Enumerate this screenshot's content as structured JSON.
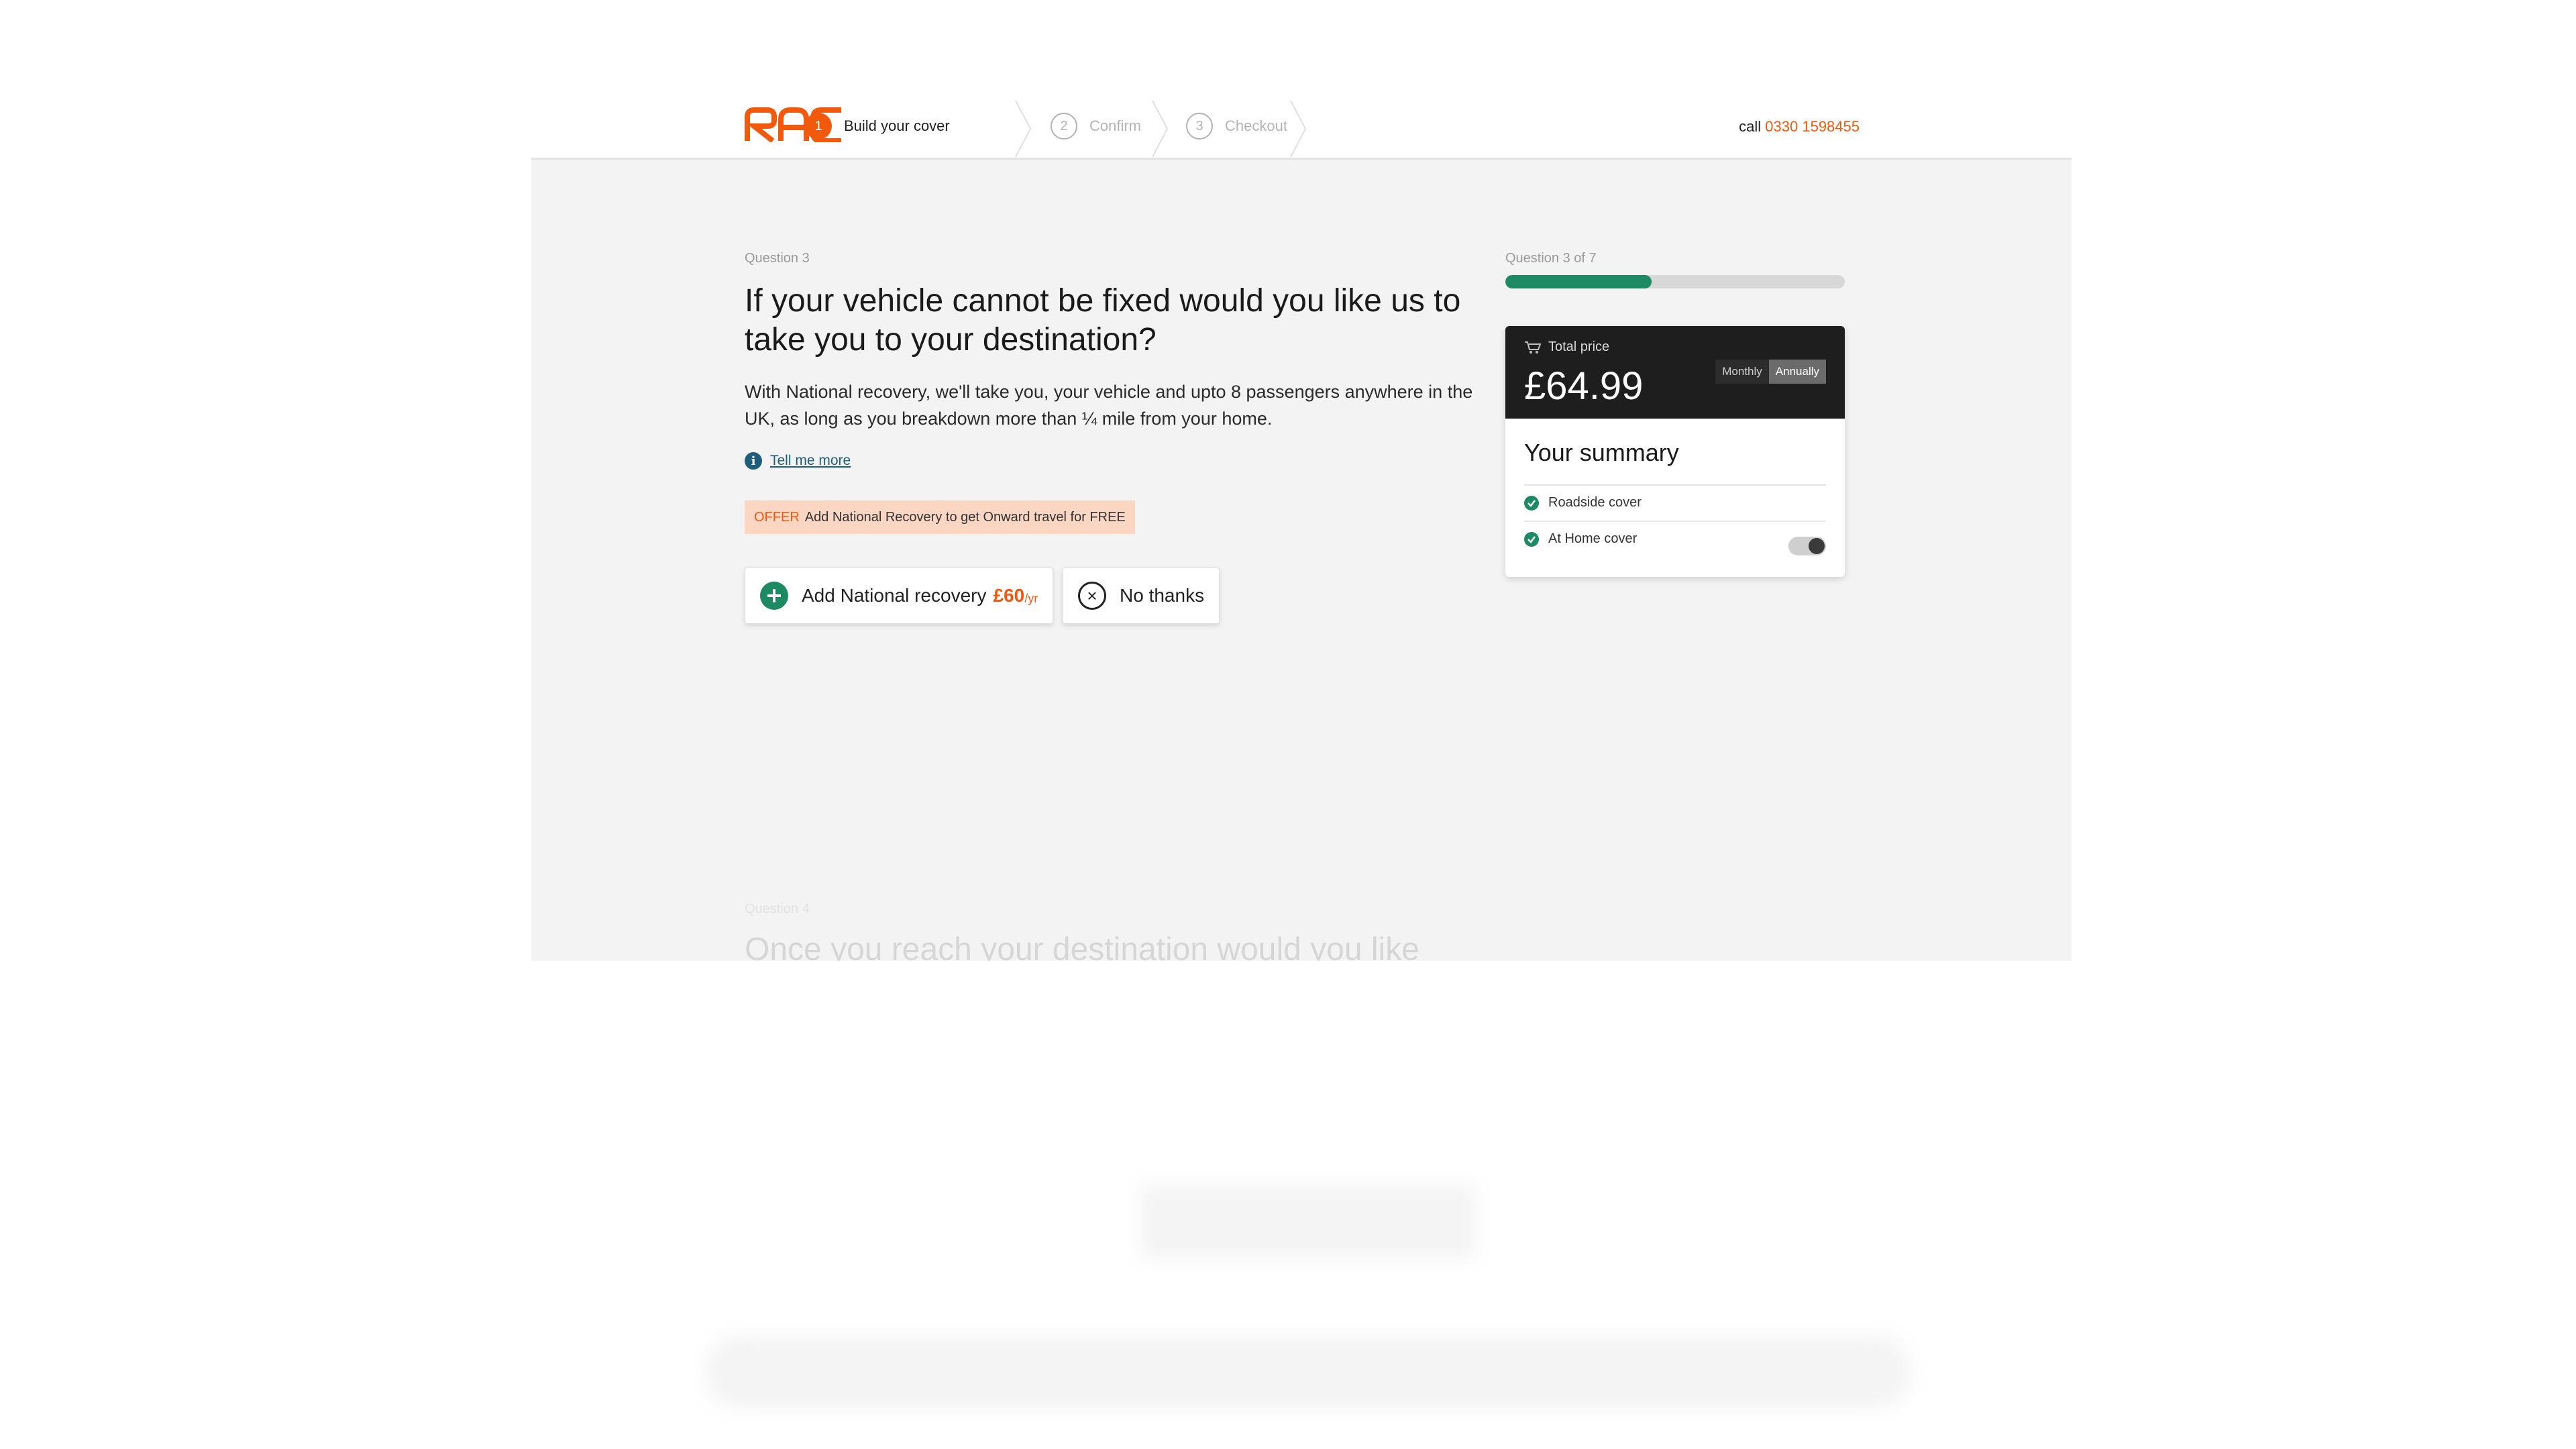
{
  "header": {
    "logo_text": "RAC",
    "steps": [
      {
        "number": "1",
        "label": "Build your cover"
      },
      {
        "number": "2",
        "label": "Confirm"
      },
      {
        "number": "3",
        "label": "Checkout"
      }
    ],
    "call_label": "call",
    "phone": "0330 1598455"
  },
  "question": {
    "label": "Question 3",
    "title": "If your vehicle cannot be fixed would you like us to take you to your destination?",
    "body": "With National recovery, we'll take you, your vehicle and upto 8 passengers anywhere in the UK, as long as you breakdown more than ¼ mile from your home.",
    "tell_more": "Tell me more",
    "offer_tag": "OFFER",
    "offer_text": "Add National Recovery to get Onward travel for FREE",
    "add_button": {
      "label": "Add National recovery",
      "price": "£60",
      "per": "/yr"
    },
    "no_button": {
      "label": "No thanks"
    }
  },
  "progress": {
    "label": "Question 3 of 7",
    "value": 0.43
  },
  "summary": {
    "total_label": "Total price",
    "total_price": "£64.99",
    "billing_options": [
      "Monthly",
      "Annually"
    ],
    "billing_selected": "Annually",
    "title": "Your summary",
    "items": [
      {
        "label": "Roadside cover"
      },
      {
        "label": "At Home cover",
        "toggle": true
      }
    ]
  },
  "next_question": {
    "label": "Question 4",
    "title": "Once you reach your destination would you like"
  },
  "colors": {
    "brand": "#f15a0c",
    "accent_green": "#1e8a64",
    "dark_panel": "#1e1e1e",
    "link": "#1f5e7a"
  }
}
